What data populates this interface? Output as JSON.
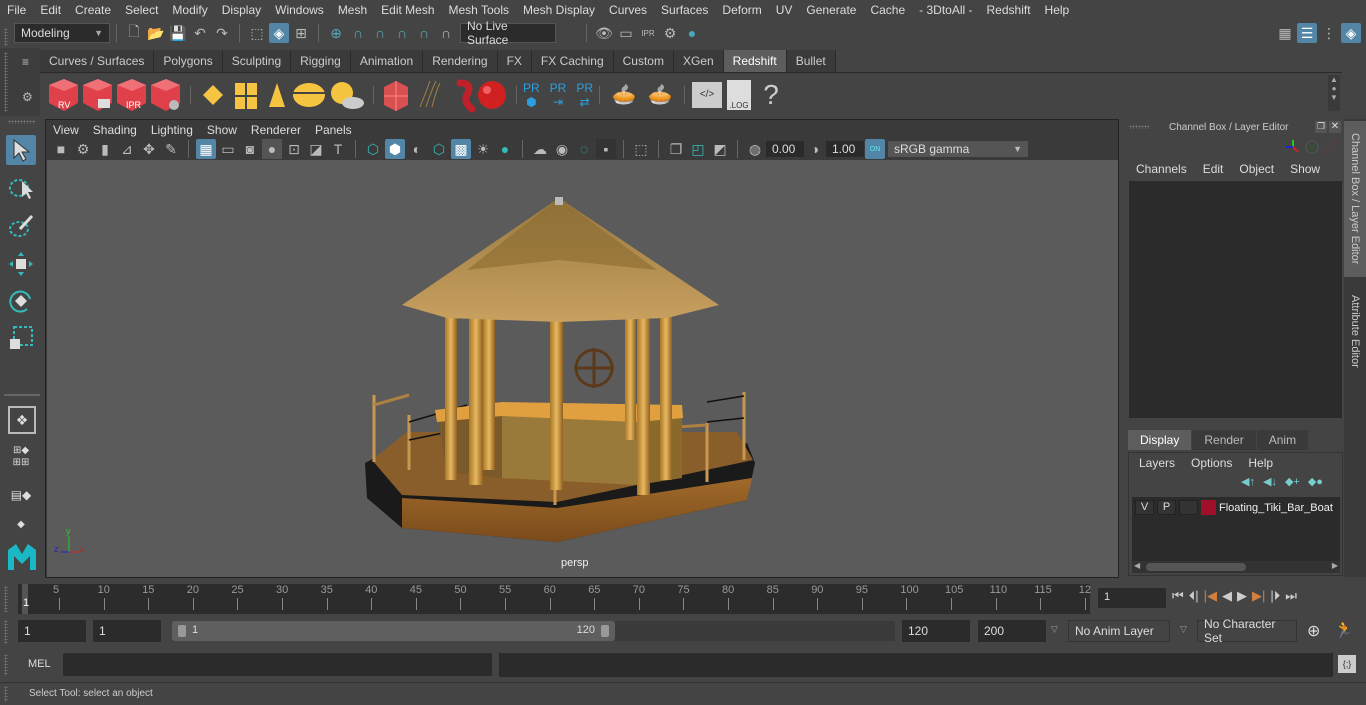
{
  "menubar": {
    "items": [
      "File",
      "Edit",
      "Create",
      "Select",
      "Modify",
      "Display",
      "Windows",
      "Mesh",
      "Edit Mesh",
      "Mesh Tools",
      "Mesh Display",
      "Curves",
      "Surfaces",
      "Deform",
      "UV",
      "Generate",
      "Cache",
      "- 3DtoAll -",
      "Redshift",
      "Help"
    ]
  },
  "statusline": {
    "workspace": "Modeling",
    "live_surface": "No Live Surface"
  },
  "shelf": {
    "tabs": [
      "Curves / Surfaces",
      "Polygons",
      "Sculpting",
      "Rigging",
      "Animation",
      "Rendering",
      "FX",
      "FX Caching",
      "Custom",
      "XGen",
      "Redshift",
      "Bullet"
    ],
    "active_tab": "Redshift",
    "icons": {
      "rv": "RV",
      "ipr": "IPR",
      "pr": "PR",
      "log": ".LOG",
      "help": "?"
    }
  },
  "viewport": {
    "menu": [
      "View",
      "Shading",
      "Lighting",
      "Show",
      "Renderer",
      "Panels"
    ],
    "exposure": "0.00",
    "gamma": "1.00",
    "color_space": "sRGB gamma",
    "camera_label": "persp",
    "axis": {
      "x": "x",
      "y": "y",
      "z": "z"
    },
    "model_name": "Floating_Tiki_Bar_Boat"
  },
  "channel_box": {
    "title": "Channel Box / Layer Editor",
    "menu": [
      "Channels",
      "Edit",
      "Object",
      "Show"
    ],
    "layer_tabs": [
      "Display",
      "Render",
      "Anim"
    ],
    "active_layer_tab": "Display",
    "layer_menu": [
      "Layers",
      "Options",
      "Help"
    ],
    "layers": [
      {
        "v": "V",
        "p": "P",
        "color": "#a0102a",
        "name": "Floating_Tiki_Bar_Boat"
      }
    ]
  },
  "side_tabs": [
    "Channel Box / Layer Editor",
    "Attribute Editor"
  ],
  "timeline": {
    "ticks": [
      "5",
      "10",
      "15",
      "20",
      "25",
      "30",
      "35",
      "40",
      "45",
      "50",
      "55",
      "60",
      "65",
      "70",
      "75",
      "80",
      "85",
      "90",
      "95",
      "100",
      "105",
      "110",
      "115",
      "12"
    ],
    "current_frame_marker": "1",
    "current_frame": "1"
  },
  "range": {
    "start": "1",
    "playback_start": "1",
    "slider_start": "1",
    "slider_end": "120",
    "playback_end": "120",
    "end": "200",
    "anim_layer": "No Anim Layer",
    "character_set": "No Character Set"
  },
  "command": {
    "label": "MEL"
  },
  "help_line": "Select Tool: select an object"
}
